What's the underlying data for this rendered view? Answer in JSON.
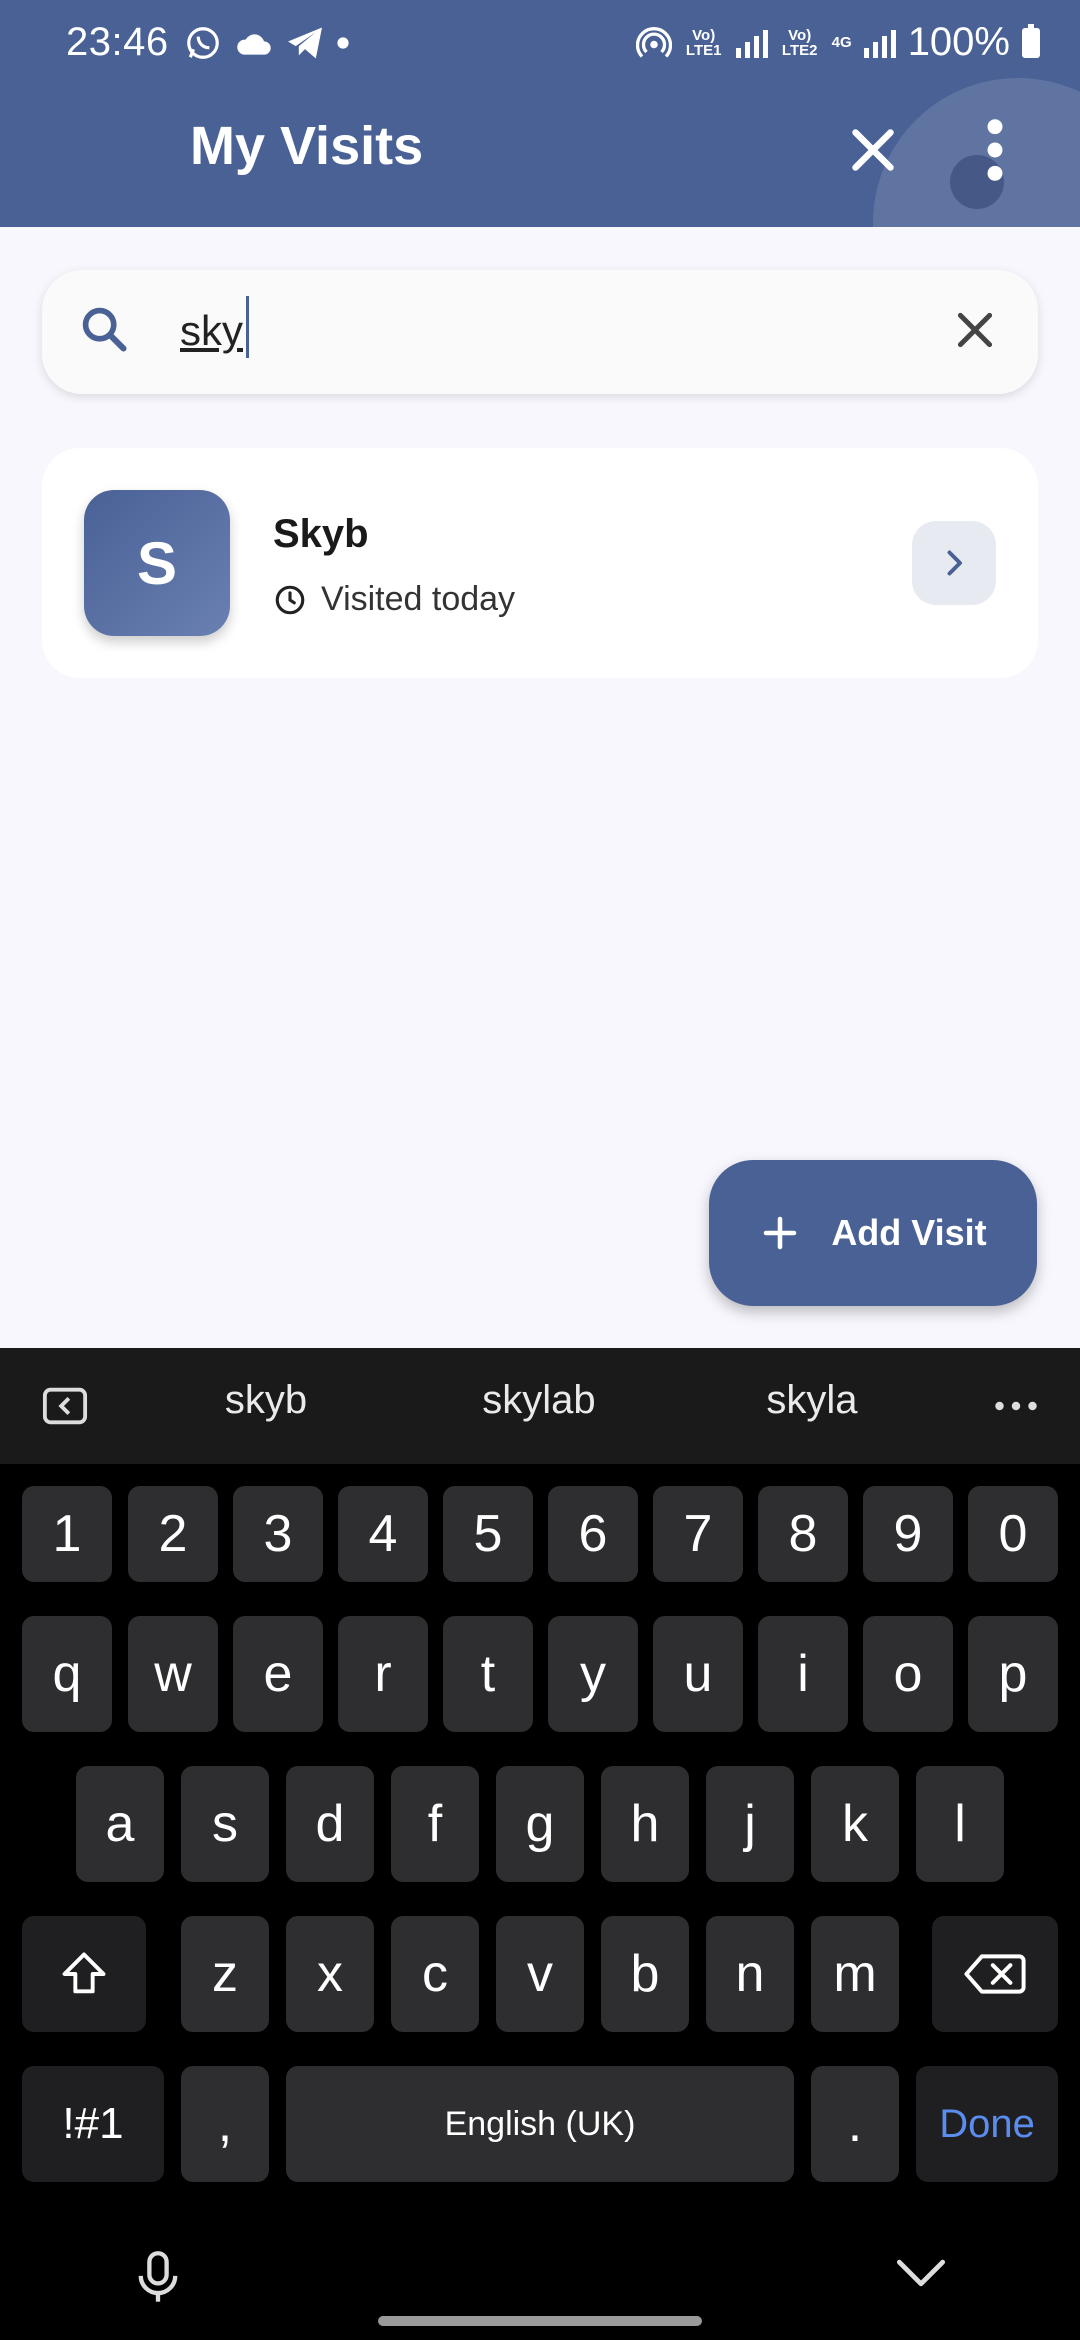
{
  "status_bar": {
    "time": "23:46",
    "battery": "100%",
    "sim1": "Vo) LTE1",
    "sim2": "Vo) LTE2",
    "network": "4G"
  },
  "header": {
    "title": "My Visits"
  },
  "search": {
    "value": "sky"
  },
  "results": [
    {
      "initial": "S",
      "name": "Skyb",
      "visited": "Visited today"
    }
  ],
  "fab": {
    "label": "Add Visit"
  },
  "keyboard": {
    "suggestions": [
      "skyb",
      "skylab",
      "skyla"
    ],
    "row_numbers": [
      "1",
      "2",
      "3",
      "4",
      "5",
      "6",
      "7",
      "8",
      "9",
      "0"
    ],
    "row1": [
      "q",
      "w",
      "e",
      "r",
      "t",
      "y",
      "u",
      "i",
      "o",
      "p"
    ],
    "row2": [
      "a",
      "s",
      "d",
      "f",
      "g",
      "h",
      "j",
      "k",
      "l"
    ],
    "row3": [
      "z",
      "x",
      "c",
      "v",
      "b",
      "n",
      "m"
    ],
    "symbols_key": "!#1",
    "comma_key": ",",
    "space_label": "English (UK)",
    "period_key": ".",
    "done_label": "Done"
  },
  "colors": {
    "primary": "#4a6196",
    "background": "#f7f7fd",
    "keyboard_bg": "#000000",
    "key_bg": "#2e2e30",
    "done_accent": "#5b8df0"
  }
}
